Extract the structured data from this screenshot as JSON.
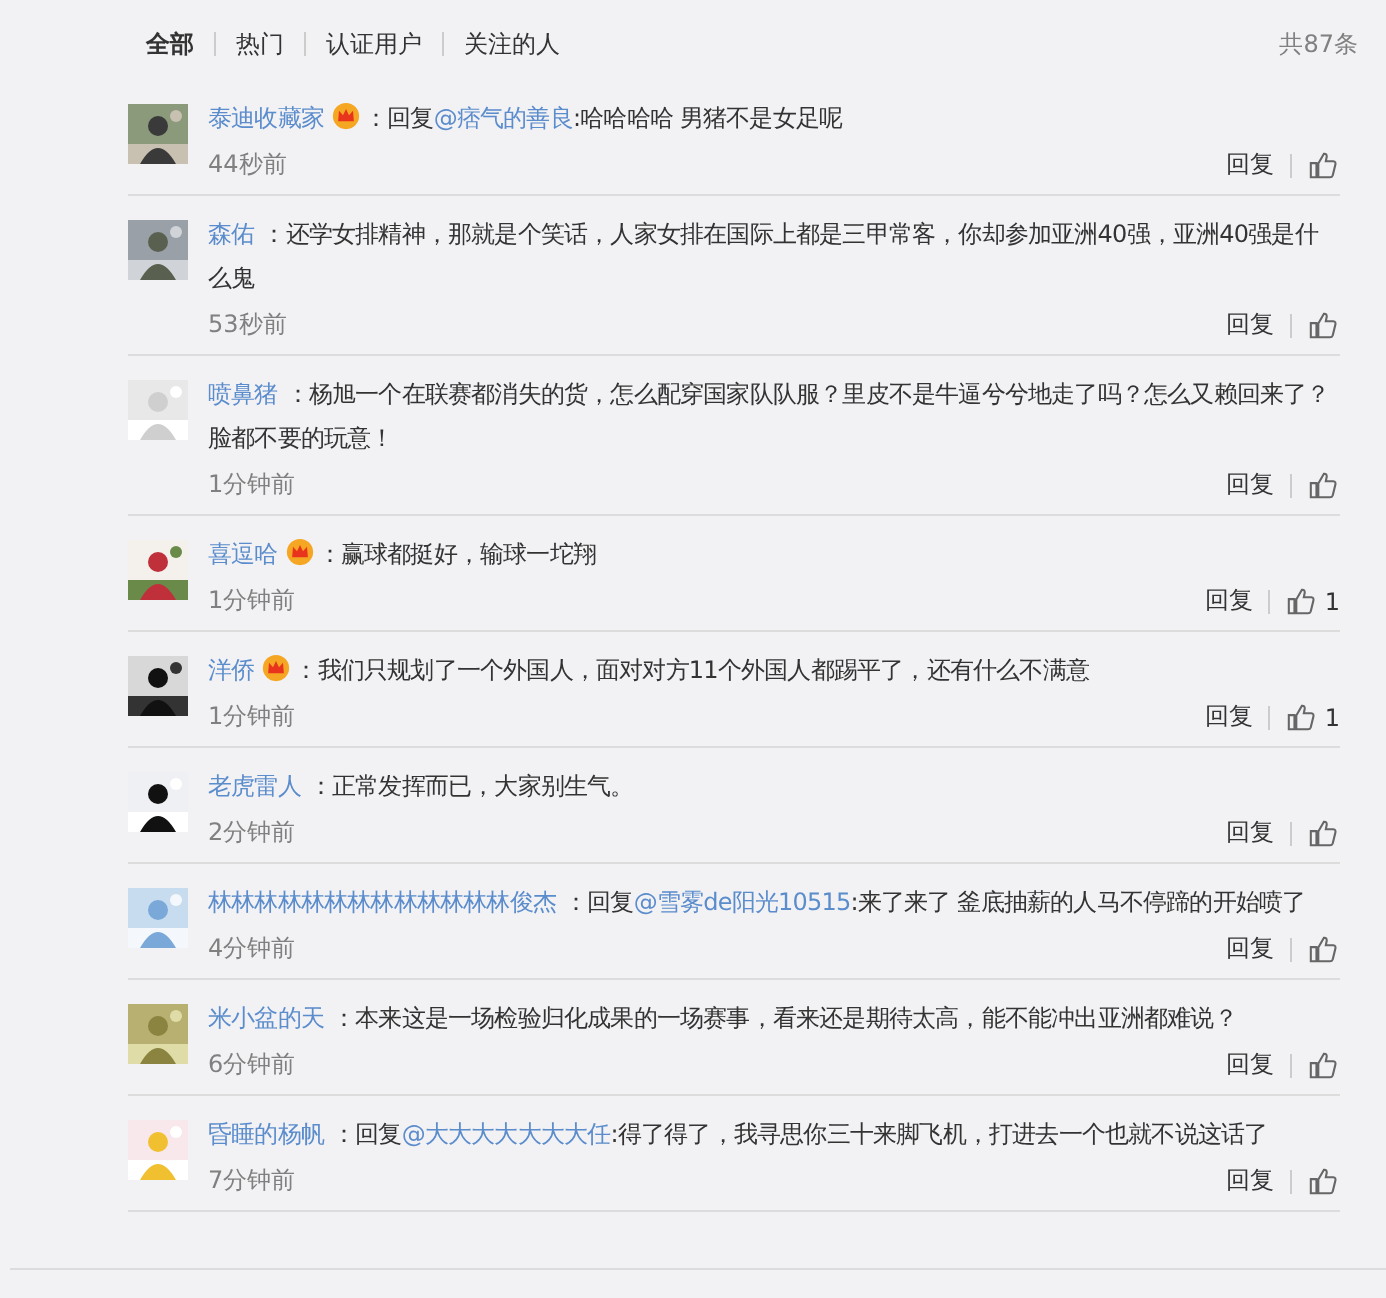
{
  "tabs": [
    {
      "label": "全部",
      "selected": true
    },
    {
      "label": "热门",
      "selected": false
    },
    {
      "label": "认证用户",
      "selected": false
    },
    {
      "label": "关注的人",
      "selected": false
    }
  ],
  "total": "共87条",
  "comments": [
    {
      "name": "泰迪收藏家",
      "vip": true,
      "segments": [
        {
          "kind": "text",
          "text": "：回复"
        },
        {
          "kind": "mention",
          "text": "@痞气的善良"
        },
        {
          "kind": "text",
          "text": ":哈哈哈哈 男猪不是女足呢"
        }
      ],
      "time": "44秒前",
      "reply": "回复"
    },
    {
      "name": "森佑",
      "vip": false,
      "segments": [
        {
          "kind": "text",
          "text": "：还学女排精神，那就是个笑话，人家女排在国际上都是三甲常客，你却参加亚洲40强，亚洲40强是什么鬼"
        }
      ],
      "time": "53秒前",
      "reply": "回复"
    },
    {
      "name": "喷鼻猪",
      "vip": false,
      "segments": [
        {
          "kind": "text",
          "text": "：杨旭一个在联赛都消失的货，怎么配穿国家队队服？里皮不是牛逼兮兮地走了吗？怎么又赖回来了？脸都不要的玩意！"
        }
      ],
      "time": "1分钟前",
      "reply": "回复"
    },
    {
      "name": "喜逗哈",
      "vip": true,
      "segments": [
        {
          "kind": "text",
          "text": "：赢球都挺好，输球一坨翔"
        }
      ],
      "time": "1分钟前",
      "reply": "回复",
      "likes": "1"
    },
    {
      "name": "洋侨",
      "vip": true,
      "segments": [
        {
          "kind": "text",
          "text": "：我们只规划了一个外国人，面对对方11个外国人都踢平了，还有什么不满意"
        }
      ],
      "time": "1分钟前",
      "reply": "回复",
      "likes": "1"
    },
    {
      "name": "老虎雷人",
      "vip": false,
      "segments": [
        {
          "kind": "text",
          "text": "：正常发挥而已，大家别生气。"
        }
      ],
      "time": "2分钟前",
      "reply": "回复"
    },
    {
      "name": "林林林林林林林林林林林林林俊杰",
      "vip": false,
      "segments": [
        {
          "kind": "text",
          "text": "：回复"
        },
        {
          "kind": "mention",
          "text": "@雪雾de阳光10515"
        },
        {
          "kind": "text",
          "text": ":来了来了 釜底抽薪的人马不停蹄的开始喷了"
        }
      ],
      "time": "4分钟前",
      "reply": "回复"
    },
    {
      "name": "米小盆的天",
      "vip": false,
      "segments": [
        {
          "kind": "text",
          "text": "：本来这是一场检验归化成果的一场赛事，看来还是期待太高，能不能冲出亚洲都难说？"
        }
      ],
      "time": "6分钟前",
      "reply": "回复"
    },
    {
      "name": "昏睡的杨帆",
      "vip": false,
      "segments": [
        {
          "kind": "text",
          "text": "：回复"
        },
        {
          "kind": "mention",
          "text": "@大大大大大大大任"
        },
        {
          "kind": "text",
          "text": ":得了得了，我寻思你三十来脚飞机，打进去一个也就不说这话了"
        }
      ],
      "time": "7分钟前",
      "reply": "回复"
    }
  ]
}
